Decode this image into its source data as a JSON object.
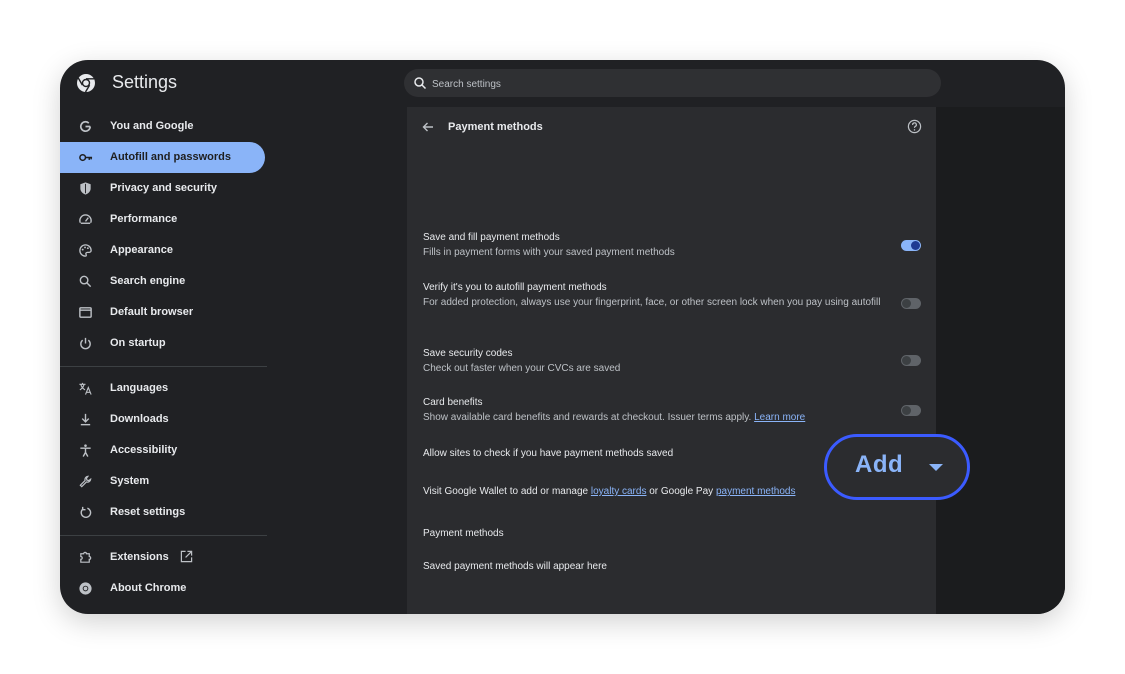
{
  "app": {
    "title": "Settings"
  },
  "search": {
    "placeholder": "Search settings"
  },
  "sidebar": {
    "items": [
      {
        "label": "You and Google",
        "icon": "google-g-icon",
        "active": false
      },
      {
        "label": "Autofill and passwords",
        "icon": "key-icon",
        "active": true
      },
      {
        "label": "Privacy and security",
        "icon": "shield-icon",
        "active": false
      },
      {
        "label": "Performance",
        "icon": "speedometer-icon",
        "active": false
      },
      {
        "label": "Appearance",
        "icon": "palette-icon",
        "active": false
      },
      {
        "label": "Search engine",
        "icon": "search-icon",
        "active": false
      },
      {
        "label": "Default browser",
        "icon": "browser-window-icon",
        "active": false
      },
      {
        "label": "On startup",
        "icon": "power-icon",
        "active": false
      },
      {
        "label": "Languages",
        "icon": "translate-icon",
        "active": false
      },
      {
        "label": "Downloads",
        "icon": "download-icon",
        "active": false
      },
      {
        "label": "Accessibility",
        "icon": "accessibility-icon",
        "active": false
      },
      {
        "label": "System",
        "icon": "wrench-icon",
        "active": false
      },
      {
        "label": "Reset settings",
        "icon": "reset-icon",
        "active": false
      },
      {
        "label": "Extensions",
        "icon": "puzzle-icon",
        "active": false
      },
      {
        "label": "About Chrome",
        "icon": "chrome-icon",
        "active": false
      }
    ]
  },
  "panel": {
    "title": "Payment methods",
    "settings": [
      {
        "title": "Save and fill payment methods",
        "desc": "Fills in payment forms with your saved payment methods",
        "enabled": true
      },
      {
        "title": "Verify it's you to autofill payment methods",
        "desc": "For added protection, always use your fingerprint, face, or other screen lock when you pay using autofill",
        "enabled": false
      },
      {
        "title": "Save security codes",
        "desc": "Check out faster when your CVCs are saved",
        "enabled": false
      },
      {
        "title": "Card benefits",
        "desc": "Show available card benefits and rewards at checkout. Issuer terms apply.",
        "link": "Learn more",
        "enabled": false
      },
      {
        "title": "Allow sites to check if you have payment methods saved",
        "enabled": false
      }
    ],
    "wallet": {
      "prefix": "Visit Google Wallet to add or manage",
      "link1": "loyalty cards",
      "middle": "or Google Pay",
      "link2": "payment methods"
    },
    "section_title": "Payment methods",
    "empty_text": "Saved payment methods will appear here",
    "add_label": "Add"
  },
  "colors": {
    "accent": "#8ab4f8",
    "highlight_ring": "#3b5bff",
    "background": "#202124"
  }
}
